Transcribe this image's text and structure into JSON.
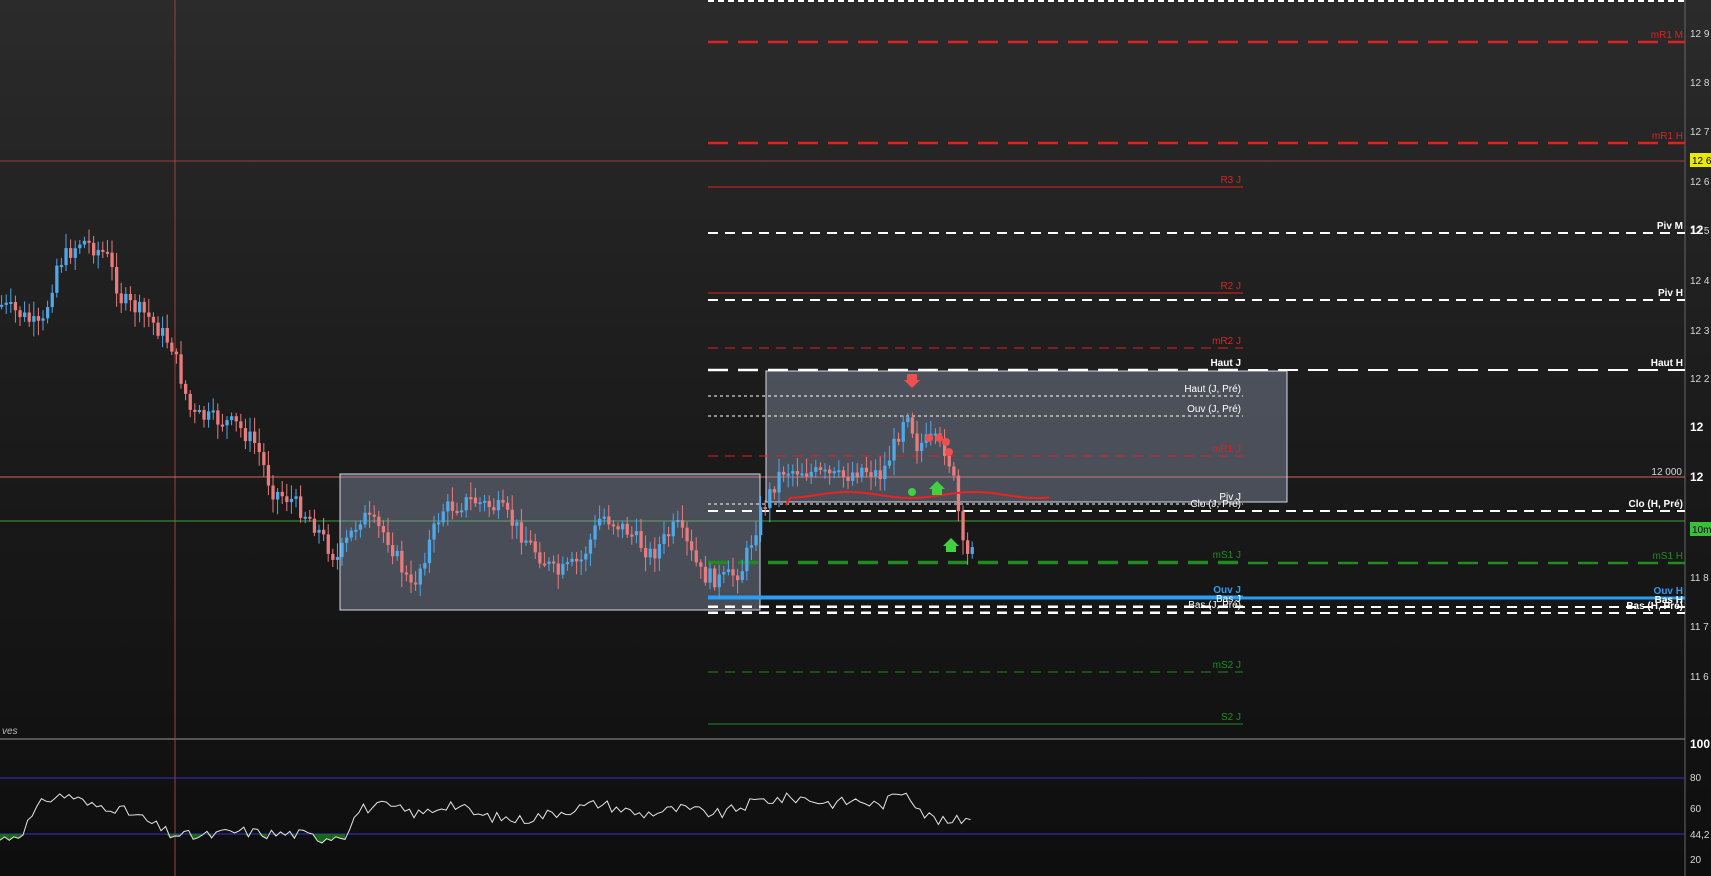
{
  "chart_data": {
    "type": "candlestick",
    "instrument_hint": "",
    "colors": {
      "up": "#4fa8e8",
      "down": "#e87c7c",
      "resistance": "#dd2222",
      "support": "#1e8c1e",
      "pivot": "#ffffff",
      "open_line": "#2a9df4",
      "box_fill": "#9aa6c0",
      "rsi_line": "#e6e6e6",
      "rsi_band": "#3333cc",
      "price_tag": "#e8e800",
      "current_tag": "#38c038"
    },
    "price_axis": {
      "ticks": [
        "12 9",
        "12 8",
        "12 7",
        "12 6",
        "12 5",
        "12",
        "12 4",
        "12 3",
        "12 2",
        "12",
        "12",
        "11 8",
        "11 7",
        "11 6"
      ],
      "bold_ticks": [
        "12",
        "12",
        "12"
      ],
      "highlight_tag": "12 6",
      "current_tag": "10m",
      "round_number_label": "12 000"
    },
    "levels": [
      {
        "label": "mR1 M",
        "color": "resistance",
        "style": "long-dash",
        "side": "right"
      },
      {
        "label": "mR1 H",
        "color": "resistance",
        "style": "long-dash",
        "side": "right"
      },
      {
        "label": "R3 J",
        "color": "resistance",
        "style": "solid",
        "side": "left"
      },
      {
        "label": "Piv M",
        "color": "pivot",
        "style": "dash",
        "side": "right"
      },
      {
        "label": "R2 J",
        "color": "resistance",
        "style": "solid",
        "side": "left"
      },
      {
        "label": "Piv H",
        "color": "pivot",
        "style": "dash",
        "side": "right"
      },
      {
        "label": "mR2 J",
        "color": "resistance",
        "style": "dash",
        "side": "left"
      },
      {
        "label": "Haut J",
        "color": "pivot",
        "style": "long-dash",
        "side": "left"
      },
      {
        "label": "Haut H",
        "color": "pivot",
        "style": "long-dash",
        "side": "right"
      },
      {
        "label": "Haut (J, Pré)",
        "color": "pivot",
        "style": "dot",
        "side": "left"
      },
      {
        "label": "Ouv (J, Pré)",
        "color": "pivot",
        "style": "dot",
        "side": "left"
      },
      {
        "label": "mR1 J",
        "color": "resistance",
        "style": "dash",
        "side": "left"
      },
      {
        "label": "Piv J",
        "color": "pivot",
        "style": "dot",
        "side": "left"
      },
      {
        "label": "Clo (J, Pré)",
        "color": "pivot",
        "style": "dash",
        "side": "left"
      },
      {
        "label": "Clo (H, Pré)",
        "color": "pivot",
        "style": "dash",
        "side": "right"
      },
      {
        "label": "mS1 J",
        "color": "support",
        "style": "long-dash",
        "side": "left"
      },
      {
        "label": "mS1 H",
        "color": "support",
        "style": "long-dash",
        "side": "right"
      },
      {
        "label": "Ouv J",
        "color": "open_line",
        "style": "solid",
        "side": "left"
      },
      {
        "label": "Ouv H",
        "color": "open_line",
        "style": "solid",
        "side": "right"
      },
      {
        "label": "Bas J",
        "color": "pivot",
        "style": "dash",
        "side": "left"
      },
      {
        "label": "Bas H",
        "color": "pivot",
        "style": "dash",
        "side": "right"
      },
      {
        "label": "Bas (J, Pré)",
        "color": "pivot",
        "style": "dash",
        "side": "left"
      },
      {
        "label": "Bas (H, Pré)",
        "color": "pivot",
        "style": "dash",
        "side": "right"
      },
      {
        "label": "mS2 J",
        "color": "support",
        "style": "dash",
        "side": "left"
      },
      {
        "label": "S2 J",
        "color": "support",
        "style": "solid",
        "side": "left"
      }
    ],
    "watermark_text": "ves",
    "rsi": {
      "ticks": [
        "100",
        "80",
        "60",
        "44,2",
        "20"
      ],
      "upper_band": 70,
      "lower_band": 30,
      "last_value": "44,2"
    }
  }
}
